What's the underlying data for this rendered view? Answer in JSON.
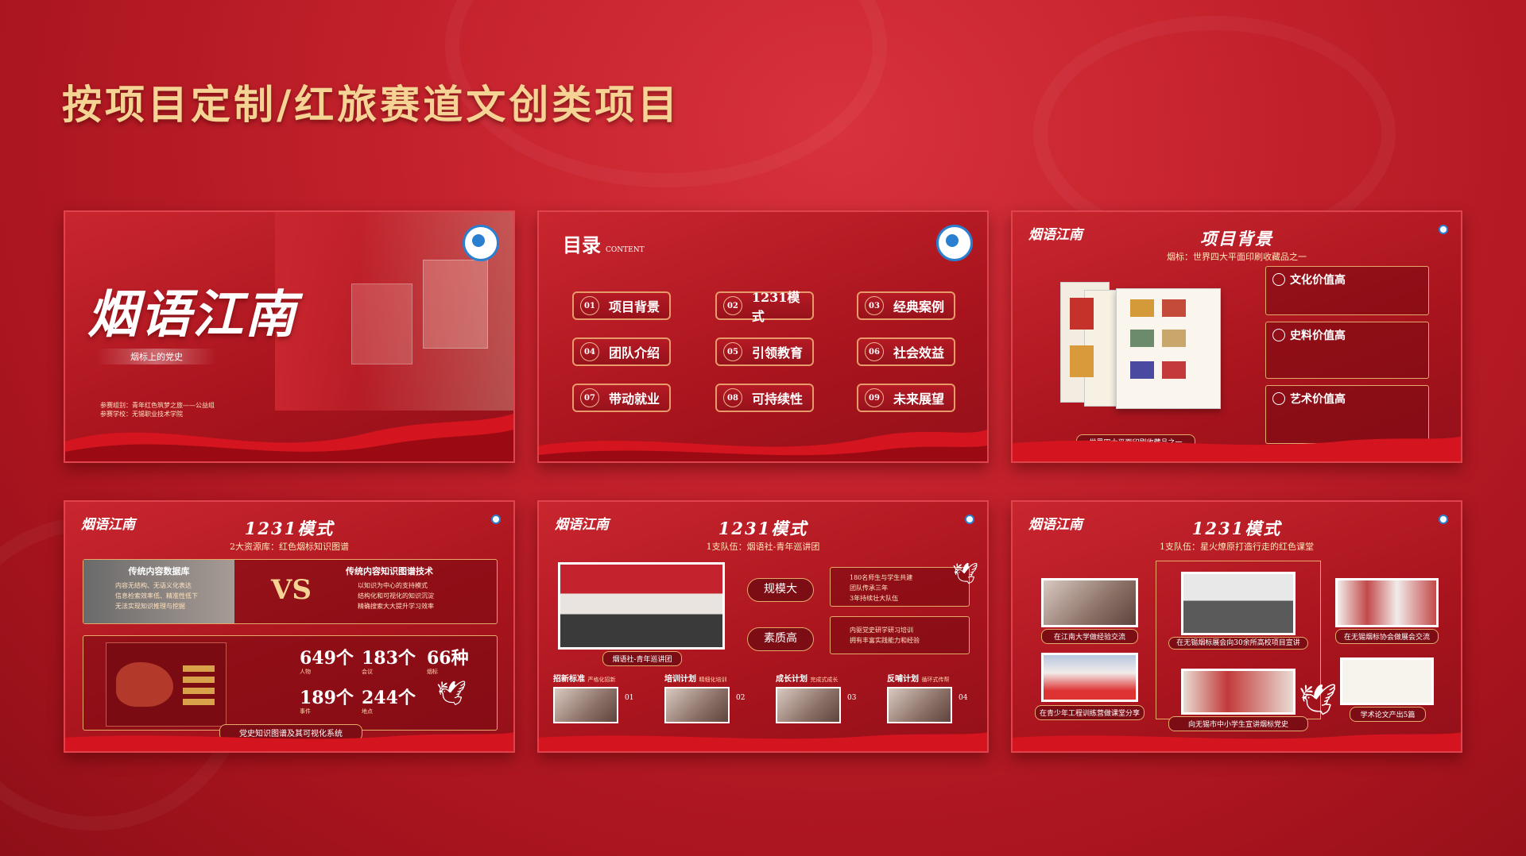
{
  "page_title": "按项目定制/红旅赛道文创类项目",
  "slide1": {
    "title": "烟语江南",
    "ribbon": "烟标上的党史",
    "info_lines": [
      "参赛组别：青年红色筑梦之旅——公益组",
      "参赛学校：无锡职业技术学院"
    ]
  },
  "slide2": {
    "title": "目录",
    "title_en": "CONTENT",
    "items": [
      {
        "num": "01",
        "label": "项目背景"
      },
      {
        "num": "02",
        "label": "1231模式"
      },
      {
        "num": "03",
        "label": "经典案例"
      },
      {
        "num": "04",
        "label": "团队介绍"
      },
      {
        "num": "05",
        "label": "引领教育"
      },
      {
        "num": "06",
        "label": "社会效益"
      },
      {
        "num": "07",
        "label": "带动就业"
      },
      {
        "num": "08",
        "label": "可持续性"
      },
      {
        "num": "09",
        "label": "未来展望"
      }
    ]
  },
  "slide3": {
    "brand": "烟语江南",
    "heading": "项目背景",
    "subheading": "烟标：世界四大平面印刷收藏品之一",
    "image_caption": "世界四大平面印刷收藏品之一",
    "values": [
      {
        "title": "文化价值高"
      },
      {
        "title": "史料价值高"
      },
      {
        "title": "艺术价值高"
      }
    ]
  },
  "slide4": {
    "brand": "烟语江南",
    "heading": "1231模式",
    "subheading": "2大资源库：红色烟标知识图谱",
    "left_title": "传统内容数据库",
    "left_items": [
      "内容无结构、无语义化表达",
      "信息检索效率低、精准性低下",
      "无法实现知识推理与挖掘"
    ],
    "vs": "VS",
    "right_title": "传统内容知识图谱技术",
    "right_items": [
      "以知识为中心的支持模式",
      "结构化和可视化的知识沉淀",
      "精确搜索大大提升学习效率"
    ],
    "stats": [
      {
        "value": "649个",
        "label": "人物"
      },
      {
        "value": "183个",
        "label": "会议"
      },
      {
        "value": "66种",
        "label": "烟标"
      },
      {
        "value": "189个",
        "label": "事件"
      },
      {
        "value": "244个",
        "label": "地点"
      }
    ],
    "footer": "党史知识图谱及其可视化系统"
  },
  "slide5": {
    "brand": "烟语江南",
    "heading": "1231模式",
    "subheading": "1支队伍：烟语社-青年巡讲团",
    "photo_caption": "烟语社-青年巡讲团",
    "tags": [
      "规模大",
      "素质高"
    ],
    "points": [
      "180名师生与学生共建",
      "团队传承三年",
      "3年持续壮大队伍",
      "内驱党史研学研习培训",
      "拥有丰富实践能力和经验"
    ],
    "steps": [
      {
        "title": "招新标准",
        "note": "严格化招新",
        "num": "01"
      },
      {
        "title": "培训计划",
        "note": "精细化培训",
        "num": "02"
      },
      {
        "title": "成长计划",
        "note": "完成式成长",
        "num": "03"
      },
      {
        "title": "反哺计划",
        "note": "循环式传帮",
        "num": "04"
      }
    ]
  },
  "slide6": {
    "brand": "烟语江南",
    "heading": "1231模式",
    "subheading": "1支队伍：星火燎原打造行走的红色课堂",
    "captions": [
      "在江南大学做经验交流",
      "在无锡烟标展会向30余所高校项目宣讲",
      "在无锡烟标协会做展会交流",
      "在青少年工程训练营做课堂分享",
      "向无锡市中小学生宣讲烟标党史",
      "学术论文产出5篇"
    ]
  }
}
